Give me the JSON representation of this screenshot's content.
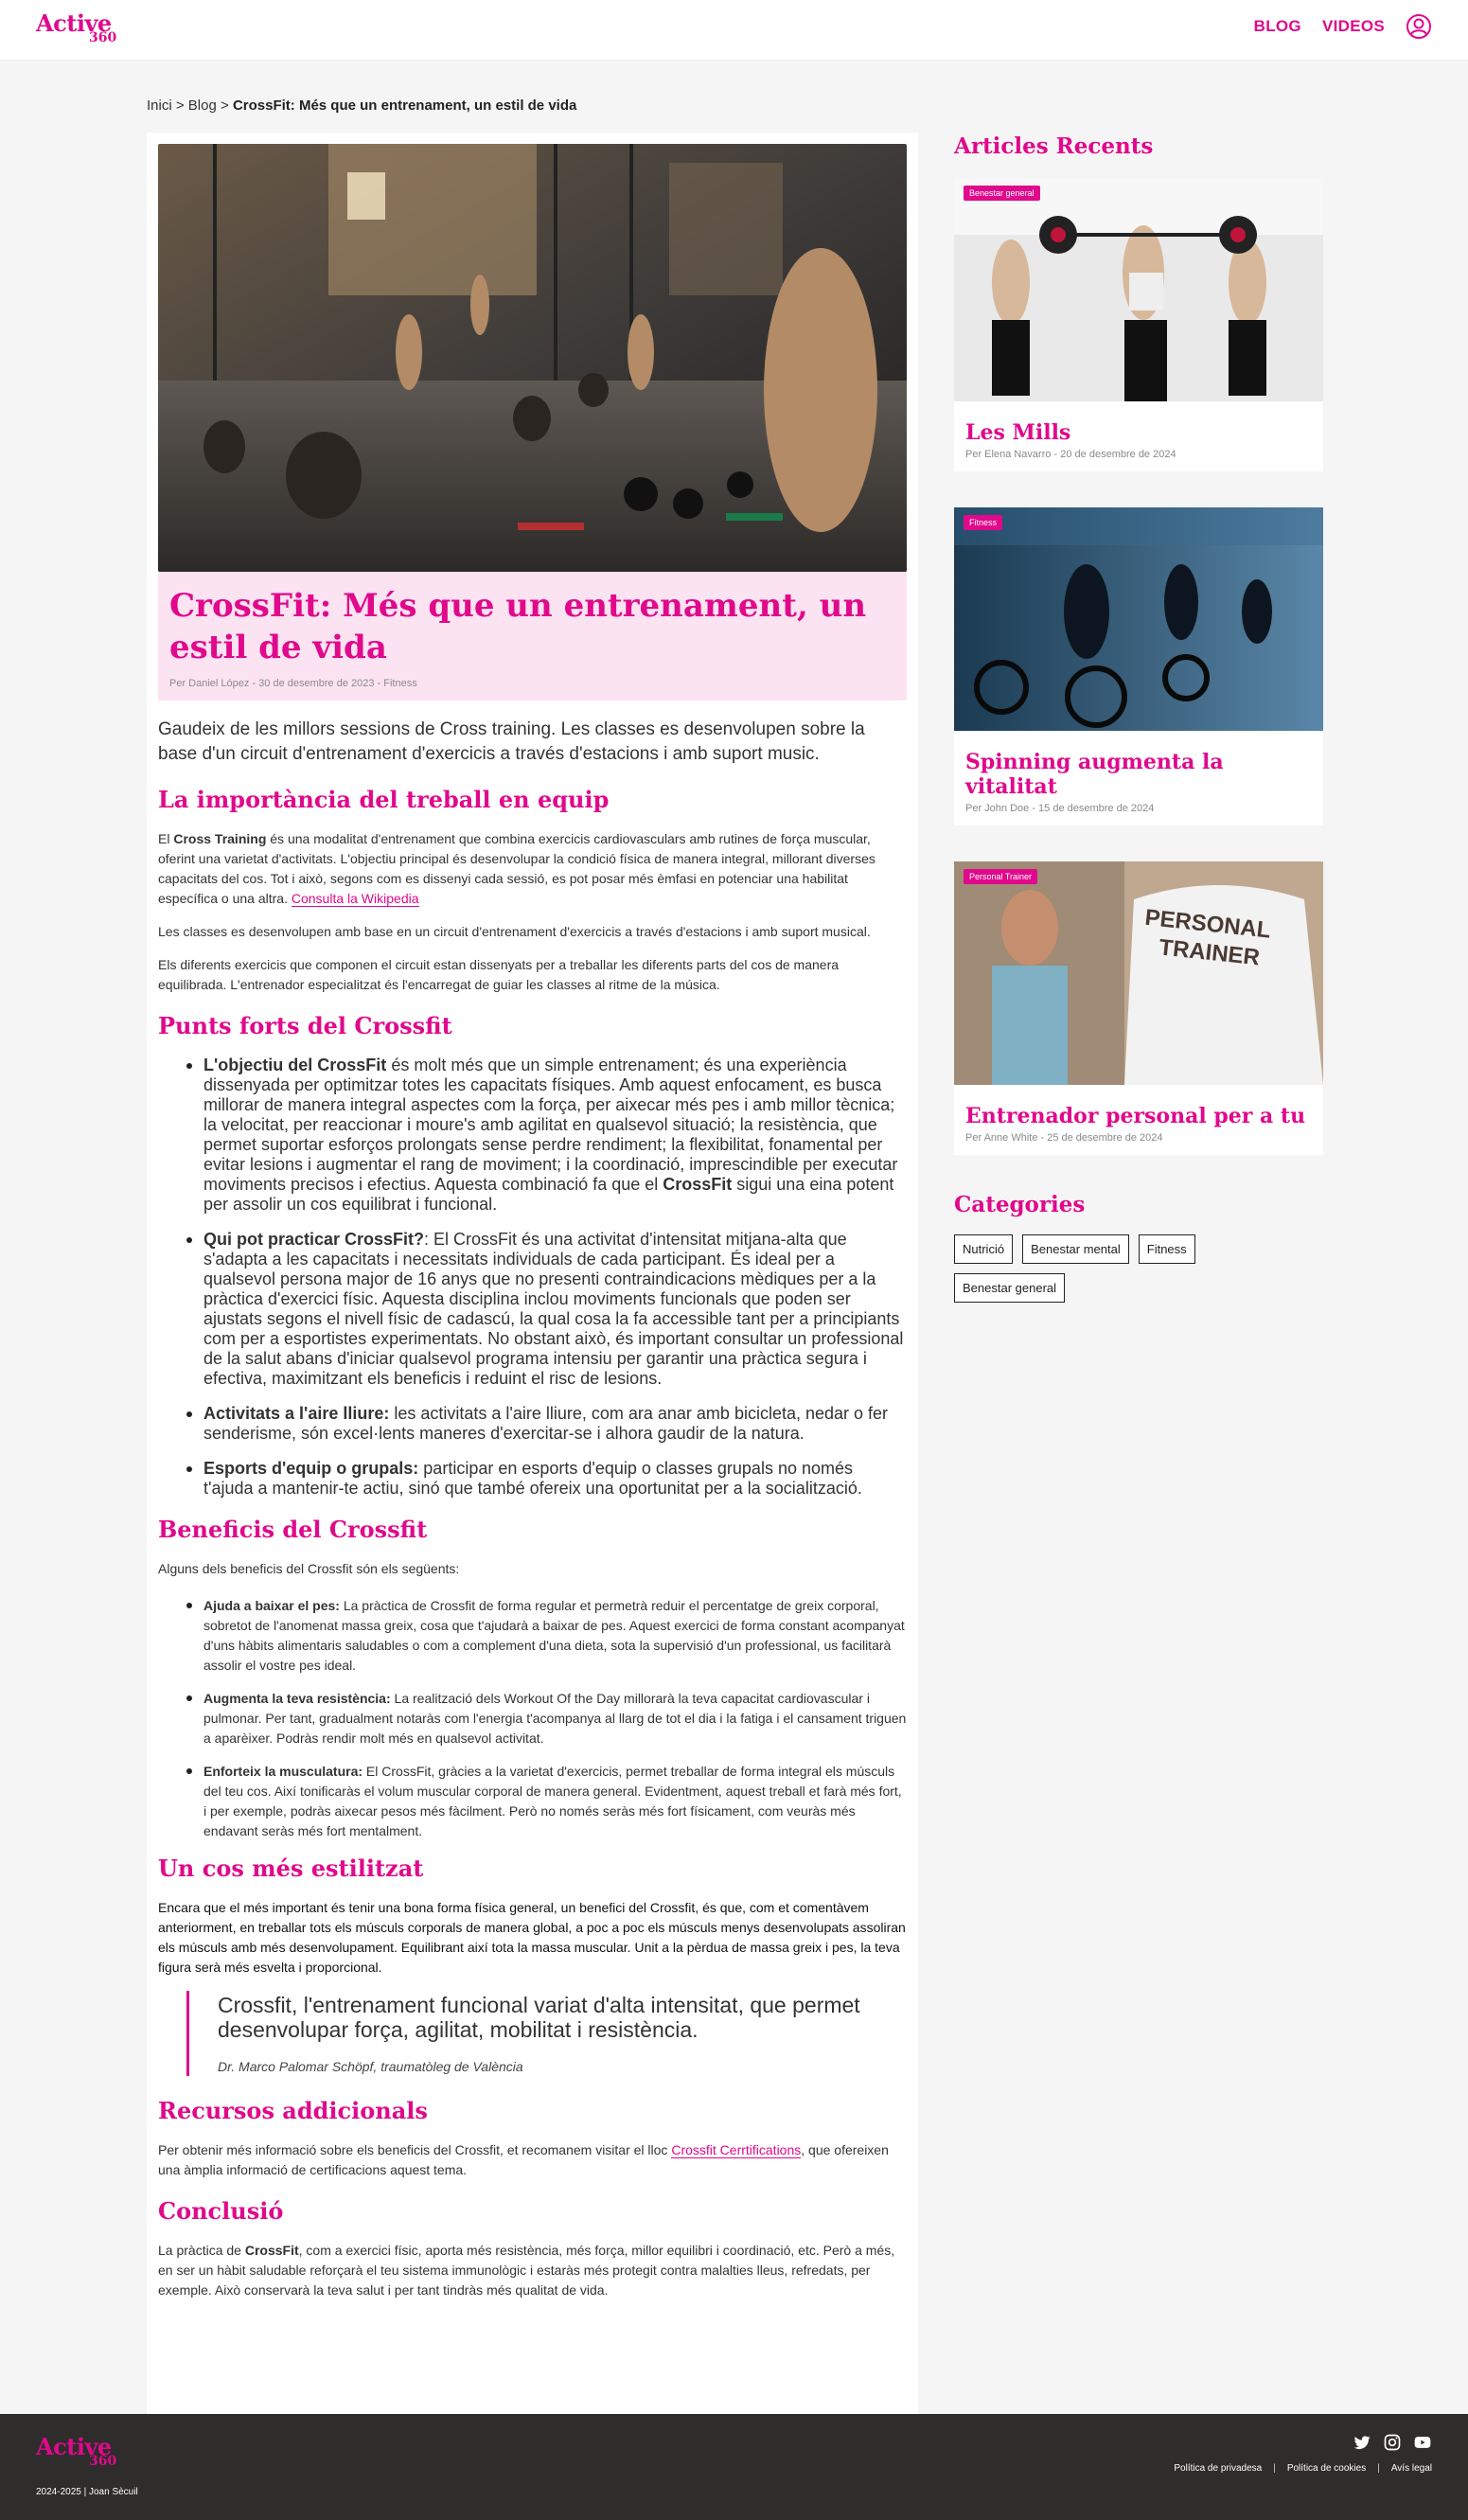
{
  "header": {
    "logo_word": "Active",
    "logo_number": "360",
    "nav": [
      "BLOG",
      "VIDEOS"
    ]
  },
  "breadcrumb": {
    "home": "Inici",
    "sep1": ">",
    "blog": "Blog",
    "sep2": ">",
    "current": "CrossFit: Més que un entrenament, un estil de vida"
  },
  "article": {
    "title": "CrossFit: Més que un entrenament, un estil de vida",
    "meta": "Per Daniel López - 30 de desembre de 2023 - Fitness",
    "lead": "Gaudeix de les millors sessions de Cross training. Les classes es desenvolupen sobre la base d'un circuit d'entrenament d'exercicis a través d'estacions i amb suport music.",
    "s1": {
      "heading": "La importància del treball en equip",
      "p1_pre": "El ",
      "p1_bold": "Cross Training",
      "p1_text": " és una modalitat d'entrenament que combina exercicis cardiovasculars amb rutines de força muscular, oferint una varietat d'activitats. L'objectiu principal és desenvolupar la condició física de manera integral, millorant diverses capacitats del cos. Tot i això, segons com es dissenyi cada sessió, es pot posar més èmfasi en potenciar una habilitat específica o una altra. ",
      "p1_link": "Consulta la Wikipedia",
      "p2": "Les classes es desenvolupen amb base en un circuit d'entrenament d'exercicis a través d'estacions i amb suport musical.",
      "p3": "Els diferents exercicis que componen el circuit estan dissenyats per a treballar les diferents parts del cos de manera equilibrada. L'entrenador especialitzat és l'encarregat de guiar les classes al ritme de la música."
    },
    "s2": {
      "heading": "Punts forts del Crossfit",
      "items": [
        {
          "bold": "L'objectiu del CrossFit",
          "text": " és molt més que un simple entrenament; és una experiència dissenyada per optimitzar totes les capacitats físiques. Amb aquest enfocament, es busca millorar de manera integral aspectes com la força, per aixecar més pes i amb millor tècnica; la velocitat, per reaccionar i moure's amb agilitat en qualsevol situació; la resistència, que permet suportar esforços prolongats sense perdre rendiment; la flexibilitat, fonamental per evitar lesions i augmentar el rang de moviment; i la coordinació, imprescindible per executar moviments precisos i efectius. Aquesta combinació fa que el ",
          "bold2": "CrossFit",
          "text2": " sigui una eina potent per assolir un cos equilibrat i funcional."
        },
        {
          "bold": "Qui pot practicar CrossFit?",
          "text": ": El CrossFit és una activitat d'intensitat mitjana-alta que s'adapta a les capacitats i necessitats individuals de cada participant. És ideal per a qualsevol persona major de 16 anys que no presenti contraindicacions mèdiques per a la pràctica d'exercici físic. Aquesta disciplina inclou moviments funcionals que poden ser ajustats segons el nivell físic de cadascú, la qual cosa la fa accessible tant per a principiants com per a esportistes experimentats. No obstant això, és important consultar un professional de la salut abans d'iniciar qualsevol programa intensiu per garantir una pràctica segura i efectiva, maximitzant els beneficis i reduint el risc de lesions."
        },
        {
          "bold": "Activitats a l'aire lliure:",
          "text": " les activitats a l'aire lliure, com ara anar amb bicicleta, nedar o fer senderisme, són excel·lents maneres d'exercitar-se i alhora gaudir de la natura."
        },
        {
          "bold": "Esports d'equip o grupals:",
          "text": " participar en esports d'equip o classes grupals no només t'ajuda a mantenir-te actiu, sinó que també ofereix una oportunitat per a la socialització."
        }
      ]
    },
    "s3": {
      "heading": "Beneficis del Crossfit",
      "intro": "Alguns dels beneficis del Crossfit són els següents:",
      "items": [
        {
          "bold": "Ajuda a baixar el pes:",
          "text": " La pràctica de Crossfit de forma regular et permetrà reduir el percentatge de greix corporal, sobretot de l'anomenat massa greix, cosa que t'ajudarà a baixar de pes. Aquest exercici de forma constant acompanyat d'uns hàbits alimentaris saludables o com a complement d'una dieta, sota la supervisió d'un professional, us facilitarà assolir el vostre pes ideal."
        },
        {
          "bold": "Augmenta la teva resistència:",
          "text": " La realització dels Workout Of the Day millorarà la teva capacitat cardiovascular i pulmonar. Per tant, gradualment notaràs com l'energia t'acompanya al llarg de tot el dia i la fatiga i el cansament triguen a aparèixer. Podràs rendir molt més en qualsevol activitat."
        },
        {
          "bold": "Enforteix la musculatura:",
          "text": " El CrossFit, gràcies a la varietat d'exercicis, permet treballar de forma integral els músculs del teu cos. Així tonificaràs el volum muscular corporal de manera general. Evidentment, aquest treball et farà més fort, i per exemple, podràs aixecar pesos més fàcilment. Però no només seràs més fort físicament, com veuràs més endavant seràs més fort mentalment."
        }
      ]
    },
    "s4": {
      "heading": "Un cos més estilitzat",
      "p": "Encara que el més important és tenir una bona forma física general, un benefici del Crossfit, és que, com et comentàvem anteriorment, en treballar tots els músculs corporals de manera global, a poc a poc els músculs menys desenvolupats assoliran els músculs amb més desenvolupament. Equilibrant així tota la massa muscular. Unit a la pèrdua de massa greix i pes, la teva figura serà més esvelta i proporcional.",
      "quote": "Crossfit, l'entrenament funcional variat d'alta intensitat, que permet desenvolupar força, agilitat, mobilitat i resistència.",
      "cite": "Dr. Marco Palomar Schöpf, traumatòleg de València"
    },
    "s5": {
      "heading": "Recursos addicionals",
      "p_pre": "Per obtenir més informació sobre els beneficis del Crossfit, et recomanem visitar el lloc ",
      "p_link": "Crossfit Cerrtifications",
      "p_post": ", que ofereixen una àmplia informació de certificacions aquest tema."
    },
    "s6": {
      "heading": "Conclusió",
      "p_pre": "La pràctica de ",
      "p_bold": "CrossFit",
      "p_post": ", com a exercici físic, aporta més resistència, més força, millor equilibri i coordinació, etc. Però a més, en ser un hàbit saludable reforçarà el teu sistema immunològic i estaràs més protegit contra malalties lleus, refredats, per exemple. Això conservarà la teva salut i per tant tindràs més qualitat de vida."
    }
  },
  "sidebar": {
    "recent_heading": "Articles Recents",
    "cards": [
      {
        "badge": "Benestar general",
        "title": "Les Mills",
        "meta": "Per Elena Navarro - 20 de desembre de 2024"
      },
      {
        "badge": "Fitness",
        "title": "Spinning augmenta la vitalitat",
        "meta": "Per John Doe - 15 de desembre de 2024"
      },
      {
        "badge": "Personal Trainer",
        "title": "Entrenador personal per a tu",
        "meta": "Per Anne White - 25 de desembre de 2024",
        "shirt_text_1": "PERSONAL",
        "shirt_text_2": "TRAINER"
      }
    ],
    "categories_heading": "Categories",
    "categories": [
      "Nutrició",
      "Benestar mental",
      "Fitness",
      "Benestar general"
    ]
  },
  "footer": {
    "copyright": "2024-2025 | Joan Sècuil",
    "links": [
      "Política de privadesa",
      "Política de cookies",
      "Avís legal"
    ],
    "separator": "|"
  },
  "colors": {
    "accent": "#e0098c",
    "title_bg": "#fbe3f1",
    "footer_bg": "#2f2c2c",
    "page_bg": "#f5f5f5"
  },
  "icons": [
    "user-icon",
    "twitter-icon",
    "instagram-icon",
    "youtube-icon"
  ]
}
